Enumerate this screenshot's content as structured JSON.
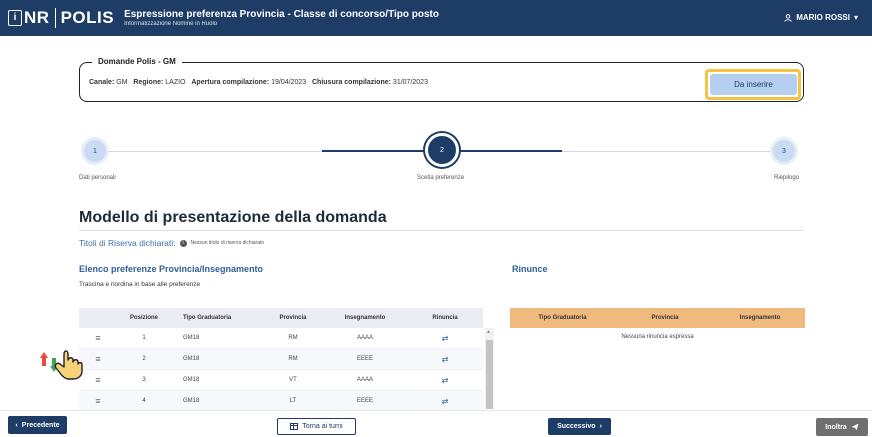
{
  "header": {
    "logo_nr": "NR",
    "logo_polis": "POLIS",
    "title": "Espressione preferenza Provincia - Classe di concorso/Tipo posto",
    "subtitle": "Informatizzazione Nomine in Ruolo",
    "user_name": "MARIO ROSSI",
    "user_caret": "▾"
  },
  "card": {
    "title": "Domande Polis - GM",
    "canale_label": "Canale:",
    "canale_value": "GM",
    "regione_label": "Regione:",
    "regione_value": "LAZIO",
    "apertura_label": "Apertura compilazione:",
    "apertura_value": "19/04/2023",
    "chiusura_label": "Chiusura compilazione:",
    "chiusura_value": "31/07/2023",
    "status_button": "Da inserire"
  },
  "stepper": {
    "steps": [
      {
        "number": "1",
        "label": "Dati personali"
      },
      {
        "number": "2",
        "label": "Scelta preferenze"
      },
      {
        "number": "3",
        "label": "Riepilogo"
      }
    ],
    "current": 2
  },
  "main": {
    "heading": "Modello di presentazione della domanda",
    "titoli_label": "Titoli di Riserva dichiarati:",
    "titoli_value": "Nessun titolo di riserva dichiarato"
  },
  "preferences": {
    "title": "Elenco preferenze Provincia/Insegnamento",
    "subtitle": "Trascina e riordina in base alle preferenze",
    "columns": [
      "Posizione",
      "Tipo Graduatoria",
      "Provincia",
      "Insegnamento",
      "Rinuncia"
    ],
    "rows": [
      {
        "posizione": "1",
        "tipo": "GM18",
        "provincia": "RM",
        "insegnamento": "AAAA"
      },
      {
        "posizione": "2",
        "tipo": "GM18",
        "provincia": "RM",
        "insegnamento": "EEEE"
      },
      {
        "posizione": "3",
        "tipo": "GM18",
        "provincia": "VT",
        "insegnamento": "AAAA"
      },
      {
        "posizione": "4",
        "tipo": "GM18",
        "provincia": "LT",
        "insegnamento": "EEEE"
      }
    ]
  },
  "rinunce": {
    "title": "Rinunce",
    "columns": [
      "Tipo Graduatoria",
      "Provincia",
      "Insegnamento"
    ],
    "empty_text": "Nessuna rinuncia espressa"
  },
  "footer": {
    "prev_label": "Precedente",
    "torna_label": "Torna ai turni",
    "next_label": "Successivo",
    "inoltra_label": "Inoltra"
  },
  "colors": {
    "primary": "#1d3c66",
    "highlight": "#f6c244",
    "rinunce_header": "#f0b97d",
    "status_button": "#b5cff0"
  }
}
